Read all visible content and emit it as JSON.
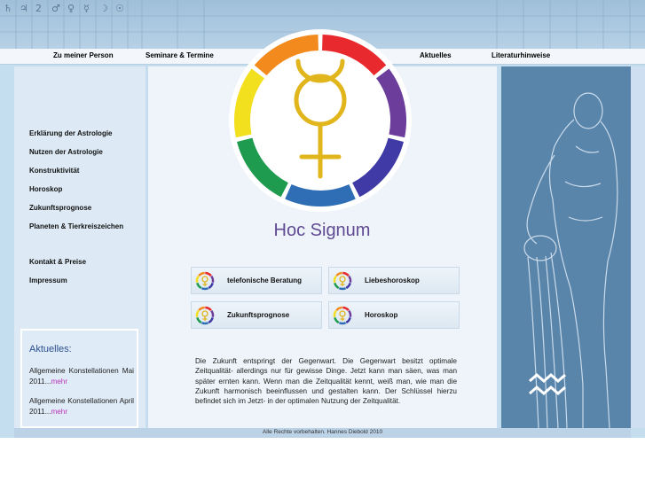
{
  "header": {
    "astro_symbols": [
      "♄",
      "♃",
      "2",
      "♂",
      "♀",
      "☿",
      "☽",
      "☉"
    ],
    "nav_items": [
      {
        "label": "Zu meiner Person",
        "color": "#d42a2a"
      },
      {
        "label": "Seminare & Termine",
        "color": "#6a4aa0"
      },
      {
        "label": "Aktuelles",
        "color": "#2d4d9c"
      },
      {
        "label": "Literaturhinweise",
        "color": "#2d4d9c"
      }
    ]
  },
  "sidebar": {
    "menu": [
      {
        "label": "Erklärung der Astrologie"
      },
      {
        "label": "Nutzen der Astrologie"
      },
      {
        "label": "Konstruktivität"
      },
      {
        "label": "Horoskop"
      },
      {
        "label": "Zukunftsprognose"
      },
      {
        "label": "Planeten & Tierkreiszeichen"
      },
      {
        "label": "Kontakt & Preise"
      },
      {
        "label": "Impressum"
      }
    ],
    "news": {
      "title": "Aktuelles:",
      "items": [
        {
          "text": "Allgemeine Konstellationen Mai 2011...",
          "more": "mehr"
        },
        {
          "text": "Allgemeine Konstellationen April 2011...",
          "more": "mehr"
        }
      ]
    }
  },
  "main": {
    "logo_icon": "mercury-color-wheel-icon",
    "site_name": "Hoc Signum",
    "services": [
      {
        "label": "telefonische Beratung",
        "icon": "mercury-wheel-icon"
      },
      {
        "label": "Liebeshoroskop",
        "icon": "mercury-wheel-icon"
      },
      {
        "label": "Zukunftsprognose",
        "icon": "mercury-wheel-icon"
      },
      {
        "label": "Horoskop",
        "icon": "mercury-wheel-icon"
      }
    ],
    "intro_text": "Die Zukunft entspringt der Gegenwart. Die Gegenwart besitzt optimale Zeitqualität- allerdings nur für gewisse Dinge. Jetzt kann man säen, was man später ernten kann. Wenn man die Zeitqualität kennt, weiß man, wie man die Zukunft harmonisch beeinflussen und gestalten kann. Der Schlüssel hierzu befindet sich im Jetzt- in der optimalen Nutzung der Zeitqualität."
  },
  "right_panel": {
    "image": "aquarius-figure-illustration",
    "symbol_icon": "aquarius-symbol-icon"
  },
  "footer": {
    "copyright": "Alle Rechte vorbehalten. Hannes Diebold 2010"
  },
  "colors": {
    "wheel": [
      "#e8292e",
      "#6c3d9a",
      "#3f3aa6",
      "#2f6eb5",
      "#1f9b4f",
      "#f2df1d",
      "#f28a1e"
    ],
    "symbol_gold": "#e1b51c",
    "accent_purple": "#5f4a93",
    "link_more": "#bb33bb"
  }
}
